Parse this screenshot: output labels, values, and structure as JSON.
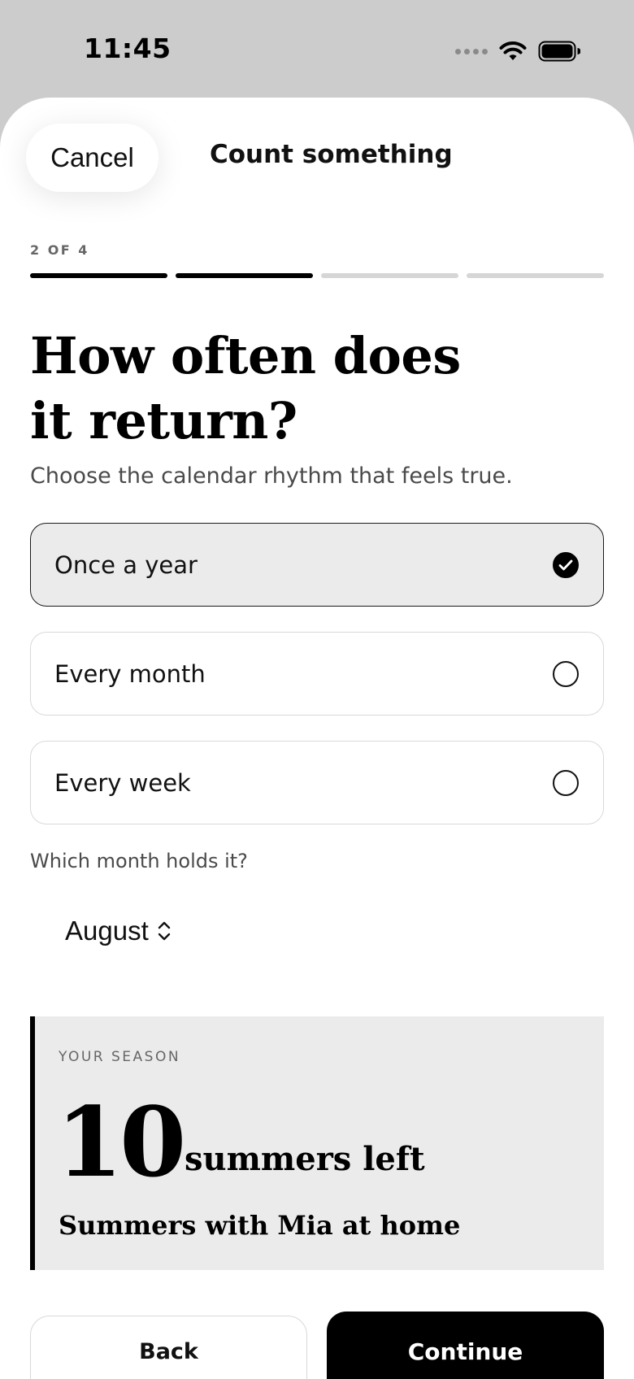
{
  "status_bar": {
    "time": "11:45",
    "icons": [
      "signal-dots-icon",
      "wifi-icon",
      "battery-icon"
    ]
  },
  "header": {
    "cancel_label": "Cancel",
    "title": "Count something"
  },
  "progress": {
    "step_label": "2 OF 4",
    "current_step": 2,
    "total_steps": 4
  },
  "question": {
    "headline_line1": "How often does",
    "headline_line2": "it return?",
    "subtitle": "Choose the calendar rhythm that feels true."
  },
  "options": [
    {
      "label": "Once a year",
      "selected": true
    },
    {
      "label": "Every month",
      "selected": false
    },
    {
      "label": "Every week",
      "selected": false
    }
  ],
  "month": {
    "label": "Which month holds it?",
    "selected": "August"
  },
  "season": {
    "eyebrow": "YOUR SEASON",
    "count": "10",
    "unit": "summers left",
    "name": "Summers with Mia at home"
  },
  "footer": {
    "back_label": "Back",
    "continue_label": "Continue"
  },
  "colors": {
    "background": "#cccccc",
    "sheet": "#ffffff",
    "accent": "#000000",
    "selected_fill": "#ebebeb",
    "track": "#d6d6d6"
  }
}
